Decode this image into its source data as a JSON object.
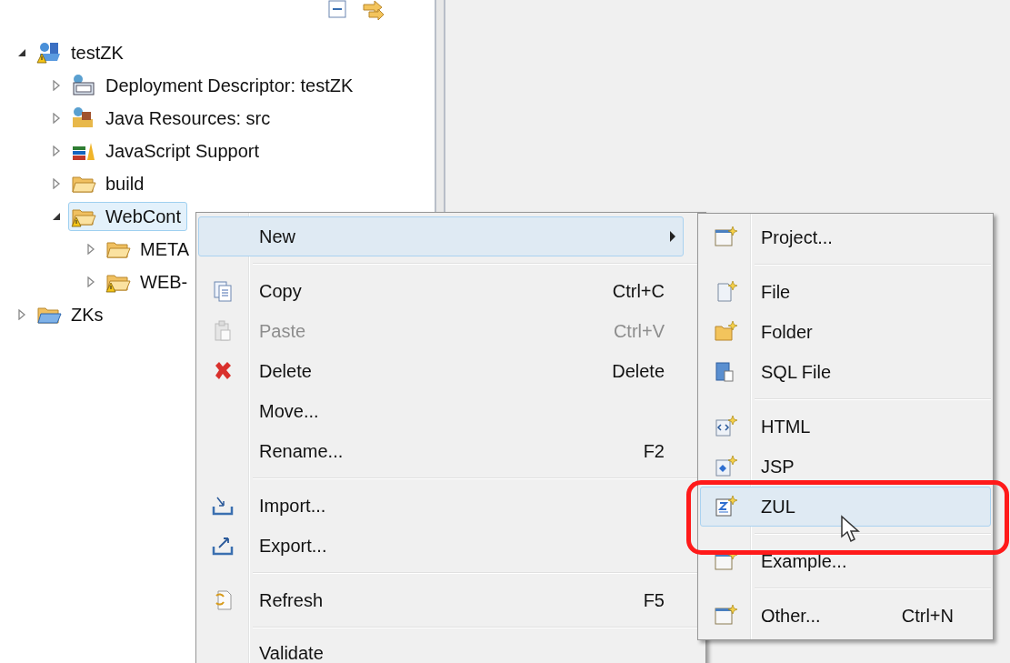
{
  "tree": [
    {
      "label": "testZK",
      "kind": "project",
      "warning": true,
      "expanded": true,
      "selected": false,
      "children": [
        {
          "label": "Deployment Descriptor: testZK",
          "kind": "descriptor",
          "expanded": false,
          "selected": false
        },
        {
          "label": "Java Resources: src",
          "kind": "java",
          "expanded": false,
          "selected": false
        },
        {
          "label": "JavaScript Support",
          "kind": "library",
          "expanded": false,
          "selected": false
        },
        {
          "label": "build",
          "kind": "folder",
          "expanded": false,
          "selected": false
        },
        {
          "label": "WebCont",
          "kind": "folder",
          "warning": true,
          "expanded": true,
          "selected": true,
          "children": [
            {
              "label": "META",
              "kind": "folder",
              "expanded": false,
              "selected": false
            },
            {
              "label": "WEB-",
              "kind": "folder",
              "warning": true,
              "expanded": false,
              "selected": false
            }
          ]
        }
      ]
    },
    {
      "label": "ZKs",
      "kind": "bluefolder",
      "expanded": false,
      "selected": false
    }
  ],
  "context_menu": [
    {
      "kind": "plain",
      "label": "New",
      "submenu": true,
      "selected": true,
      "disabled": false
    },
    {
      "kind": "separator"
    },
    {
      "kind": "copy",
      "label": "Copy",
      "shortcut": "Ctrl+C",
      "selected": false,
      "disabled": false
    },
    {
      "kind": "paste",
      "label": "Paste",
      "shortcut": "Ctrl+V",
      "selected": false,
      "disabled": true
    },
    {
      "kind": "delete",
      "label": "Delete",
      "shortcut": "Delete",
      "selected": false,
      "disabled": false
    },
    {
      "kind": "plain",
      "label": "Move...",
      "selected": false,
      "disabled": false
    },
    {
      "kind": "plain",
      "label": "Rename...",
      "shortcut": "F2",
      "selected": false,
      "disabled": false
    },
    {
      "kind": "separator"
    },
    {
      "kind": "import",
      "label": "Import...",
      "selected": false,
      "disabled": false
    },
    {
      "kind": "export",
      "label": "Export...",
      "selected": false,
      "disabled": false
    },
    {
      "kind": "separator"
    },
    {
      "kind": "refresh",
      "label": "Refresh",
      "shortcut": "F5",
      "selected": false,
      "disabled": false
    },
    {
      "kind": "separator"
    },
    {
      "kind": "plain",
      "label": "Validate",
      "selected": false,
      "disabled": false
    }
  ],
  "submenu": [
    {
      "kind": "newproject",
      "label": "Project...",
      "selected": false
    },
    {
      "kind": "separator"
    },
    {
      "kind": "newfile",
      "label": "File",
      "selected": false
    },
    {
      "kind": "newfolder",
      "label": "Folder",
      "selected": false
    },
    {
      "kind": "sql",
      "label": "SQL File",
      "selected": false
    },
    {
      "kind": "separator"
    },
    {
      "kind": "html",
      "label": "HTML",
      "selected": false
    },
    {
      "kind": "jsp",
      "label": "JSP",
      "selected": false
    },
    {
      "kind": "zul",
      "label": "ZUL",
      "selected": true
    },
    {
      "kind": "separator"
    },
    {
      "kind": "newproject",
      "label": "Example...",
      "selected": false
    },
    {
      "kind": "separator"
    },
    {
      "kind": "newproject",
      "label": "Other...",
      "shortcut": "Ctrl+N",
      "selected": false
    }
  ]
}
